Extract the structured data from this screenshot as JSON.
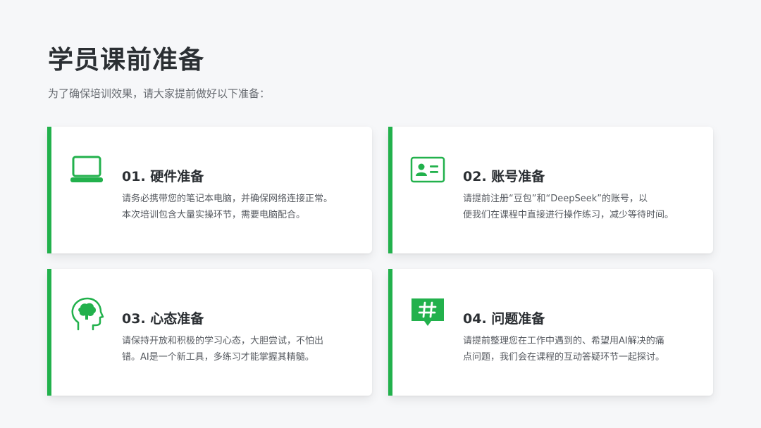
{
  "page": {
    "title": "学员课前准备",
    "subtitle": "为了确保培训效果，请大家提前做好以下准备："
  },
  "colors": {
    "accent": "#22b14c",
    "title": "#2b2f33",
    "text": "#55595f",
    "background": "#f6f7f9"
  },
  "cards": [
    {
      "icon": "laptop-icon",
      "title": "01. 硬件准备",
      "lines": [
        "请务必携带您的笔记本电脑，并确保网络连接正常。",
        "本次培训包含大量实操环节，需要电脑配合。"
      ]
    },
    {
      "icon": "id-card-icon",
      "title": "02. 账号准备",
      "lines": [
        "请提前注册“豆包”和“DeepSeek”的账号，以",
        "便我们在课程中直接进行操作练习，减少等待时间。"
      ]
    },
    {
      "icon": "brain-head-icon",
      "title": "03. 心态准备",
      "lines": [
        "请保持开放和积极的学习心态，大胆尝试，不怕出",
        "错。AI是一个新工具，多练习才能掌握其精髓。"
      ]
    },
    {
      "icon": "hashtag-icon",
      "title": "04. 问题准备",
      "lines": [
        "请提前整理您在工作中遇到的、希望用AI解决的痛",
        "点问题，我们会在课程的互动答疑环节一起探讨。"
      ]
    }
  ]
}
